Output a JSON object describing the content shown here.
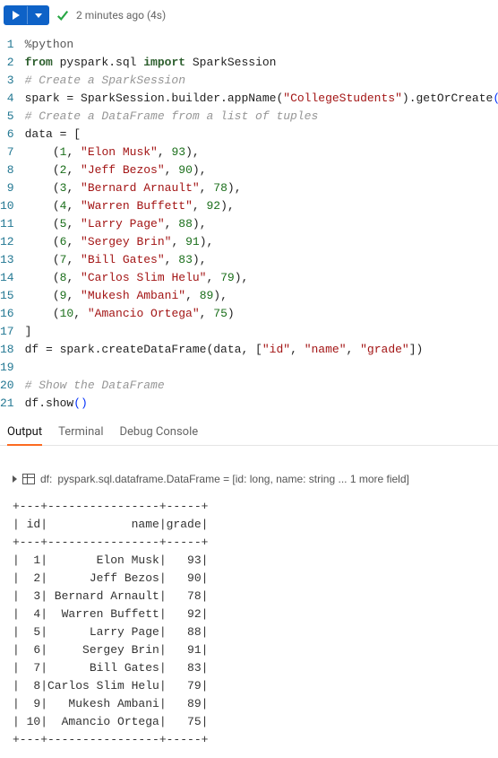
{
  "toolbar": {
    "status": "2 minutes ago (4s)"
  },
  "code": {
    "lines": [
      {
        "n": 1,
        "tokens": [
          {
            "t": "%python",
            "c": "tok-magic"
          }
        ]
      },
      {
        "n": 2,
        "tokens": [
          {
            "t": "from ",
            "c": "tok-kw"
          },
          {
            "t": "pyspark.sql ",
            "c": "tok-ident"
          },
          {
            "t": "import ",
            "c": "tok-import"
          },
          {
            "t": "SparkSession",
            "c": "tok-ident"
          }
        ]
      },
      {
        "n": 3,
        "tokens": [
          {
            "t": "# Create a SparkSession",
            "c": "tok-comment"
          }
        ]
      },
      {
        "n": 4,
        "tokens": [
          {
            "t": "spark = SparkSession.builder.appName(",
            "c": "tok-ident"
          },
          {
            "t": "\"CollegeStudents\"",
            "c": "tok-str"
          },
          {
            "t": ").getOrCreate",
            "c": "tok-ident"
          },
          {
            "t": "()",
            "c": "tok-paren"
          }
        ]
      },
      {
        "n": 5,
        "tokens": [
          {
            "t": "# Create a DataFrame from a list of tuples",
            "c": "tok-comment"
          }
        ]
      },
      {
        "n": 6,
        "tokens": [
          {
            "t": "data = [",
            "c": "tok-ident"
          }
        ]
      },
      {
        "n": 7,
        "tokens": [
          {
            "t": "    (",
            "c": "tok-ident"
          },
          {
            "t": "1",
            "c": "tok-num"
          },
          {
            "t": ", ",
            "c": "tok-punc"
          },
          {
            "t": "\"Elon Musk\"",
            "c": "tok-str"
          },
          {
            "t": ", ",
            "c": "tok-punc"
          },
          {
            "t": "93",
            "c": "tok-num"
          },
          {
            "t": "),",
            "c": "tok-punc"
          }
        ]
      },
      {
        "n": 8,
        "tokens": [
          {
            "t": "    (",
            "c": "tok-ident"
          },
          {
            "t": "2",
            "c": "tok-num"
          },
          {
            "t": ", ",
            "c": "tok-punc"
          },
          {
            "t": "\"Jeff Bezos\"",
            "c": "tok-str"
          },
          {
            "t": ", ",
            "c": "tok-punc"
          },
          {
            "t": "90",
            "c": "tok-num"
          },
          {
            "t": "),",
            "c": "tok-punc"
          }
        ]
      },
      {
        "n": 9,
        "tokens": [
          {
            "t": "    (",
            "c": "tok-ident"
          },
          {
            "t": "3",
            "c": "tok-num"
          },
          {
            "t": ", ",
            "c": "tok-punc"
          },
          {
            "t": "\"Bernard Arnault\"",
            "c": "tok-str"
          },
          {
            "t": ", ",
            "c": "tok-punc"
          },
          {
            "t": "78",
            "c": "tok-num"
          },
          {
            "t": "),",
            "c": "tok-punc"
          }
        ]
      },
      {
        "n": 10,
        "tokens": [
          {
            "t": "    (",
            "c": "tok-ident"
          },
          {
            "t": "4",
            "c": "tok-num"
          },
          {
            "t": ", ",
            "c": "tok-punc"
          },
          {
            "t": "\"Warren Buffett\"",
            "c": "tok-str"
          },
          {
            "t": ", ",
            "c": "tok-punc"
          },
          {
            "t": "92",
            "c": "tok-num"
          },
          {
            "t": "),",
            "c": "tok-punc"
          }
        ]
      },
      {
        "n": 11,
        "tokens": [
          {
            "t": "    (",
            "c": "tok-ident"
          },
          {
            "t": "5",
            "c": "tok-num"
          },
          {
            "t": ", ",
            "c": "tok-punc"
          },
          {
            "t": "\"Larry Page\"",
            "c": "tok-str"
          },
          {
            "t": ", ",
            "c": "tok-punc"
          },
          {
            "t": "88",
            "c": "tok-num"
          },
          {
            "t": "),",
            "c": "tok-punc"
          }
        ]
      },
      {
        "n": 12,
        "tokens": [
          {
            "t": "    (",
            "c": "tok-ident"
          },
          {
            "t": "6",
            "c": "tok-num"
          },
          {
            "t": ", ",
            "c": "tok-punc"
          },
          {
            "t": "\"Sergey Brin\"",
            "c": "tok-str"
          },
          {
            "t": ", ",
            "c": "tok-punc"
          },
          {
            "t": "91",
            "c": "tok-num"
          },
          {
            "t": "),",
            "c": "tok-punc"
          }
        ]
      },
      {
        "n": 13,
        "tokens": [
          {
            "t": "    (",
            "c": "tok-ident"
          },
          {
            "t": "7",
            "c": "tok-num"
          },
          {
            "t": ", ",
            "c": "tok-punc"
          },
          {
            "t": "\"Bill Gates\"",
            "c": "tok-str"
          },
          {
            "t": ", ",
            "c": "tok-punc"
          },
          {
            "t": "83",
            "c": "tok-num"
          },
          {
            "t": "),",
            "c": "tok-punc"
          }
        ]
      },
      {
        "n": 14,
        "tokens": [
          {
            "t": "    (",
            "c": "tok-ident"
          },
          {
            "t": "8",
            "c": "tok-num"
          },
          {
            "t": ", ",
            "c": "tok-punc"
          },
          {
            "t": "\"Carlos Slim Helu\"",
            "c": "tok-str"
          },
          {
            "t": ", ",
            "c": "tok-punc"
          },
          {
            "t": "79",
            "c": "tok-num"
          },
          {
            "t": "),",
            "c": "tok-punc"
          }
        ]
      },
      {
        "n": 15,
        "tokens": [
          {
            "t": "    (",
            "c": "tok-ident"
          },
          {
            "t": "9",
            "c": "tok-num"
          },
          {
            "t": ", ",
            "c": "tok-punc"
          },
          {
            "t": "\"Mukesh Ambani\"",
            "c": "tok-str"
          },
          {
            "t": ", ",
            "c": "tok-punc"
          },
          {
            "t": "89",
            "c": "tok-num"
          },
          {
            "t": "),",
            "c": "tok-punc"
          }
        ]
      },
      {
        "n": 16,
        "tokens": [
          {
            "t": "    (",
            "c": "tok-ident"
          },
          {
            "t": "10",
            "c": "tok-num"
          },
          {
            "t": ", ",
            "c": "tok-punc"
          },
          {
            "t": "\"Amancio Ortega\"",
            "c": "tok-str"
          },
          {
            "t": ", ",
            "c": "tok-punc"
          },
          {
            "t": "75",
            "c": "tok-num"
          },
          {
            "t": ")",
            "c": "tok-punc"
          }
        ]
      },
      {
        "n": 17,
        "tokens": [
          {
            "t": "]",
            "c": "tok-ident"
          }
        ]
      },
      {
        "n": 18,
        "tokens": [
          {
            "t": "df = spark.createDataFrame(data, [",
            "c": "tok-ident"
          },
          {
            "t": "\"id\"",
            "c": "tok-str"
          },
          {
            "t": ", ",
            "c": "tok-punc"
          },
          {
            "t": "\"name\"",
            "c": "tok-str"
          },
          {
            "t": ", ",
            "c": "tok-punc"
          },
          {
            "t": "\"grade\"",
            "c": "tok-str"
          },
          {
            "t": "])",
            "c": "tok-ident"
          }
        ]
      },
      {
        "n": 19,
        "tokens": [
          {
            "t": " ",
            "c": ""
          }
        ]
      },
      {
        "n": 20,
        "tokens": [
          {
            "t": "# Show the DataFrame",
            "c": "tok-comment"
          }
        ]
      },
      {
        "n": 21,
        "tokens": [
          {
            "t": "df.show",
            "c": "tok-ident"
          },
          {
            "t": "()",
            "c": "tok-paren"
          }
        ]
      }
    ]
  },
  "tabs": {
    "items": [
      {
        "label": "Output",
        "active": true
      },
      {
        "label": "Terminal",
        "active": false
      },
      {
        "label": "Debug Console",
        "active": false
      }
    ]
  },
  "output": {
    "caption": {
      "prefix": "df:  ",
      "body": "pyspark.sql.dataframe.DataFrame = [id: long, name: string ... 1 more field]"
    },
    "table": {
      "divider": "+---+----------------+-----+",
      "header": "| id|            name|grade|",
      "rows": [
        "|  1|       Elon Musk|   93|",
        "|  2|      Jeff Bezos|   90|",
        "|  3| Bernard Arnault|   78|",
        "|  4|  Warren Buffett|   92|",
        "|  5|      Larry Page|   88|",
        "|  6|     Sergey Brin|   91|",
        "|  7|      Bill Gates|   83|",
        "|  8|Carlos Slim Helu|   79|",
        "|  9|   Mukesh Ambani|   89|",
        "| 10|  Amancio Ortega|   75|"
      ]
    }
  }
}
